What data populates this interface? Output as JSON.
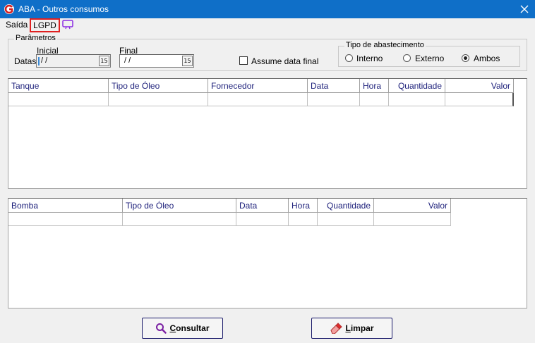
{
  "window": {
    "title": "ABA - Outros consumos",
    "app_icon": "app-logo-icon",
    "close_icon": "close-icon"
  },
  "menu": {
    "saida": "Saída",
    "lgpd": "LGPD",
    "screen_icon": "screen-icon"
  },
  "parametros": {
    "legend": "Parâmetros",
    "datas_label": "Datas",
    "inicial_label": "Inicial",
    "final_label": "Final",
    "inicial_value": " /  /",
    "final_value": " /  /",
    "cal_label": "15",
    "assume_label": "Assume data final",
    "assume_checked": false
  },
  "tipo": {
    "legend": "Tipo de abastecimento",
    "options": [
      "Interno",
      "Externo",
      "Ambos"
    ],
    "selected": "Ambos"
  },
  "table1": {
    "columns": [
      "Tanque",
      "Tipo de Óleo",
      "Fornecedor",
      "Data",
      "Hora",
      "Quantidade",
      "Valor"
    ]
  },
  "table2": {
    "columns": [
      "Bomba",
      "Tipo de Óleo",
      "Data",
      "Hora",
      "Quantidade",
      "Valor"
    ]
  },
  "buttons": {
    "consultar_first": "C",
    "consultar_rest": "onsultar",
    "limpar_first": "L",
    "limpar_rest": "impar"
  },
  "colors": {
    "titlebar": "#0f6fc8",
    "header_text": "#1c1f7a",
    "lgpd_border": "#e02020",
    "screen_icon": "#8a2be2"
  }
}
